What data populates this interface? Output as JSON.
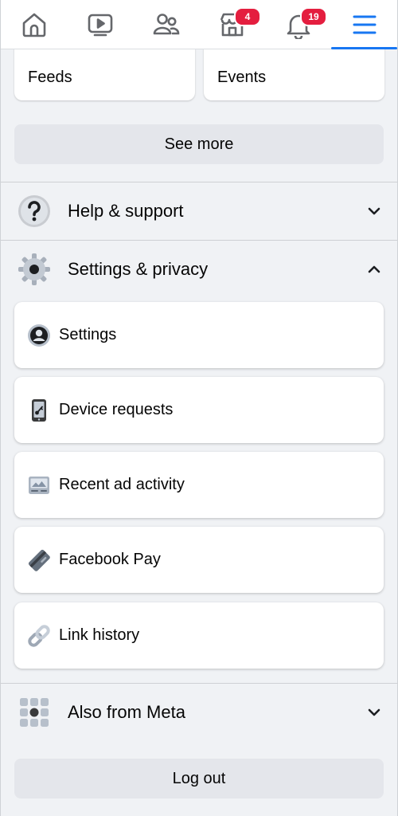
{
  "nav": {
    "items": [
      {
        "icon": "home-icon"
      },
      {
        "icon": "video-icon"
      },
      {
        "icon": "friends-icon"
      },
      {
        "icon": "marketplace-icon",
        "badge": "4"
      },
      {
        "icon": "notifications-icon",
        "badge": "19"
      },
      {
        "icon": "menu-icon",
        "active": true
      }
    ],
    "accent": "#1877f2",
    "badge_color": "#e41e3f"
  },
  "shortcuts": {
    "cards": [
      {
        "label": "Feeds"
      },
      {
        "label": "Events"
      }
    ],
    "see_more": "See more"
  },
  "help_support": {
    "label": "Help & support",
    "icon": "help-icon",
    "expanded": false
  },
  "settings_privacy": {
    "label": "Settings & privacy",
    "icon": "gear-icon",
    "expanded": true,
    "items": [
      {
        "label": "Settings",
        "icon": "account-icon"
      },
      {
        "label": "Device requests",
        "icon": "phone-key-icon"
      },
      {
        "label": "Recent ad activity",
        "icon": "ad-activity-icon"
      },
      {
        "label": "Facebook Pay",
        "icon": "payment-card-icon"
      },
      {
        "label": "Link history",
        "icon": "link-icon"
      }
    ]
  },
  "also_from_meta": {
    "label": "Also from Meta",
    "icon": "apps-grid-icon",
    "expanded": false
  },
  "log_out": "Log out"
}
